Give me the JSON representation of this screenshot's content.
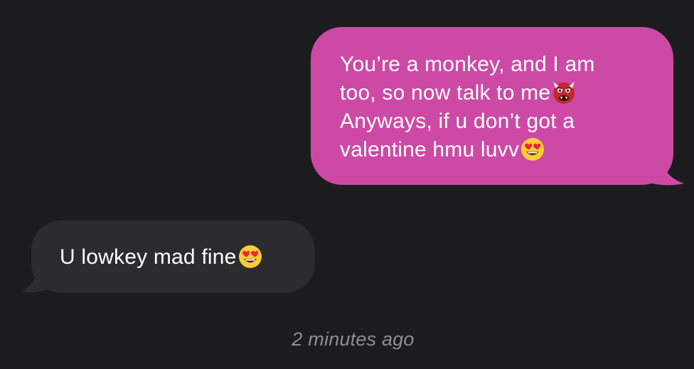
{
  "messages": [
    {
      "direction": "outgoing",
      "lines": [
        "You’re a monkey, and I am",
        "too, so now talk to me",
        "Anyways, if u don’t got a",
        "valentine hmu luvv"
      ],
      "emojis": [
        "ogre-emoji",
        "heart-eyes-emoji"
      ]
    },
    {
      "direction": "incoming",
      "lines": [
        "U lowkey mad fine"
      ],
      "emojis": [
        "heart-eyes-emoji"
      ]
    }
  ],
  "timestamp": "2 minutes ago",
  "colors": {
    "background": "#1c1c1e",
    "outgoing_bubble": "#cc4aa5",
    "incoming_bubble": "#2c2c2f",
    "timestamp_text": "#8e8e93"
  }
}
